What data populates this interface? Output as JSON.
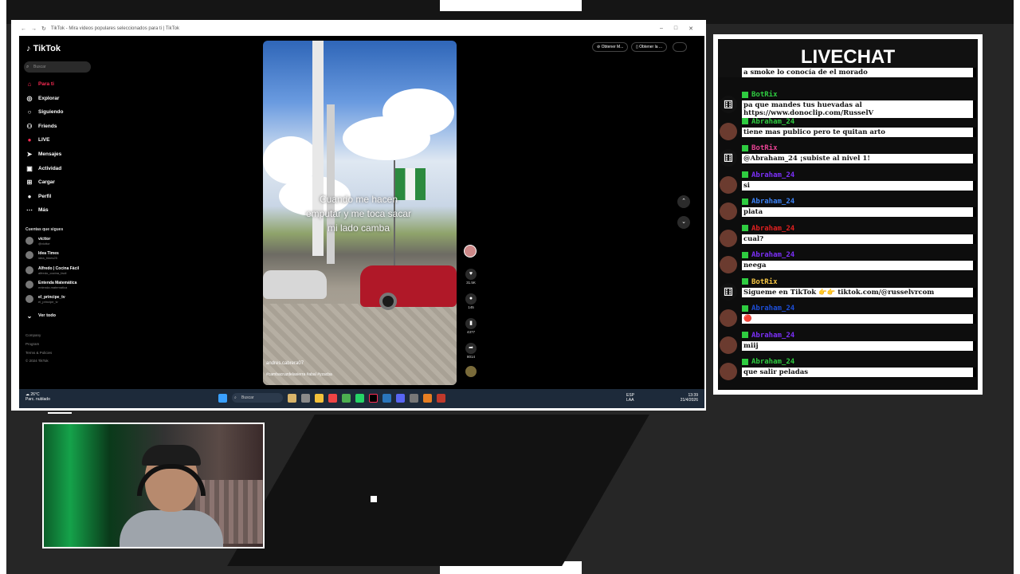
{
  "browser": {
    "tab_title": "TikTok - Mira videos populares seleccionados para ti | TikTok",
    "btn_get_app": "Obtener M...",
    "btn_get_other": "Obtener la ..."
  },
  "sidebar": {
    "logo": "TikTok",
    "search_placeholder": "Buscar",
    "items": [
      {
        "label": "Para ti",
        "icon": "home-icon"
      },
      {
        "label": "Explorar",
        "icon": "compass-icon"
      },
      {
        "label": "Siguiendo",
        "icon": "following-icon"
      },
      {
        "label": "Friends",
        "icon": "friends-icon"
      },
      {
        "label": "LIVE",
        "icon": "live-icon"
      },
      {
        "label": "Mensajes",
        "icon": "messages-icon"
      },
      {
        "label": "Actividad",
        "icon": "activity-icon"
      },
      {
        "label": "Cargar",
        "icon": "upload-icon"
      },
      {
        "label": "Perfil",
        "icon": "profile-icon"
      },
      {
        "label": "Más",
        "icon": "more-icon"
      }
    ],
    "following_title": "Cuentas que sigues",
    "following": [
      {
        "name": "victtor",
        "handle": "@victtor"
      },
      {
        "name": "Idea Times",
        "handle": "idea_times25"
      },
      {
        "name": "Alfredo | Cocina Fácil",
        "handle": "alfredo_cocina_facil"
      },
      {
        "name": "Entenda Matemática",
        "handle": "entenda.matematica"
      },
      {
        "name": "el_principe_tv",
        "handle": "el_principe_tv"
      }
    ],
    "see_all": "Ver todo",
    "footer": [
      "Company",
      "Program",
      "Terms & Policies",
      "© 2024 TikTok"
    ]
  },
  "video": {
    "caption_lines": [
      "Cuando me hacen",
      "emputar y me toca sacar",
      "mi lado camba"
    ],
    "author": "andres.cabrera07",
    "tags": "#cambacruzdelasierra #abal #yzacba"
  },
  "actions": {
    "likes": "31.5K",
    "comments": "145",
    "saves": "4377",
    "shares": "8014"
  },
  "taskbar": {
    "temp": "26°C",
    "weather": "Parc. nublado",
    "search": "Buscar",
    "lang1": "ESP",
    "lang2": "LAA",
    "time": "13:39",
    "date": "21/4/2026"
  },
  "livechat": {
    "title": "LIVECHAT",
    "messages": [
      {
        "user": "",
        "text": "a smoke lo conocía de el morado",
        "color": "#ffffff"
      },
      {
        "user": "BotRix",
        "text": "pa que mandes tus huevadas al https://www.donoclip.com/RusselV",
        "color": "#2ecc40"
      },
      {
        "user": "Abraham_24",
        "text": "tiene mas publico pero te quitan arto",
        "color": "#2ecc40"
      },
      {
        "user": "BotRix",
        "text": "@Abraham_24 ¡subiste al nivel 1!",
        "color": "#e84393"
      },
      {
        "user": "Abraham_24",
        "text": "si",
        "color": "#7b2ff7"
      },
      {
        "user": "Abraham_24",
        "text": "plata",
        "color": "#3b82f6"
      },
      {
        "user": "Abraham_24",
        "text": "cual?",
        "color": "#e02020"
      },
      {
        "user": "Abraham_24",
        "text": "neega",
        "color": "#7b2ff7"
      },
      {
        "user": "BotRix",
        "text": "Sigueme en TikTok 👉👉 tiktok.com/@russelvrcom",
        "color": "#f5c542"
      },
      {
        "user": "Abraham_24",
        "text": "🔴",
        "color": "#1d4ed8"
      },
      {
        "user": "Abraham_24",
        "text": "miij",
        "color": "#7b2ff7"
      },
      {
        "user": "Abraham_24",
        "text": "que salir peladas",
        "color": "#2ecc40"
      }
    ]
  },
  "colors": {
    "tiktok_red": "#fe2c55",
    "taskbar": "#1d2a3a"
  }
}
